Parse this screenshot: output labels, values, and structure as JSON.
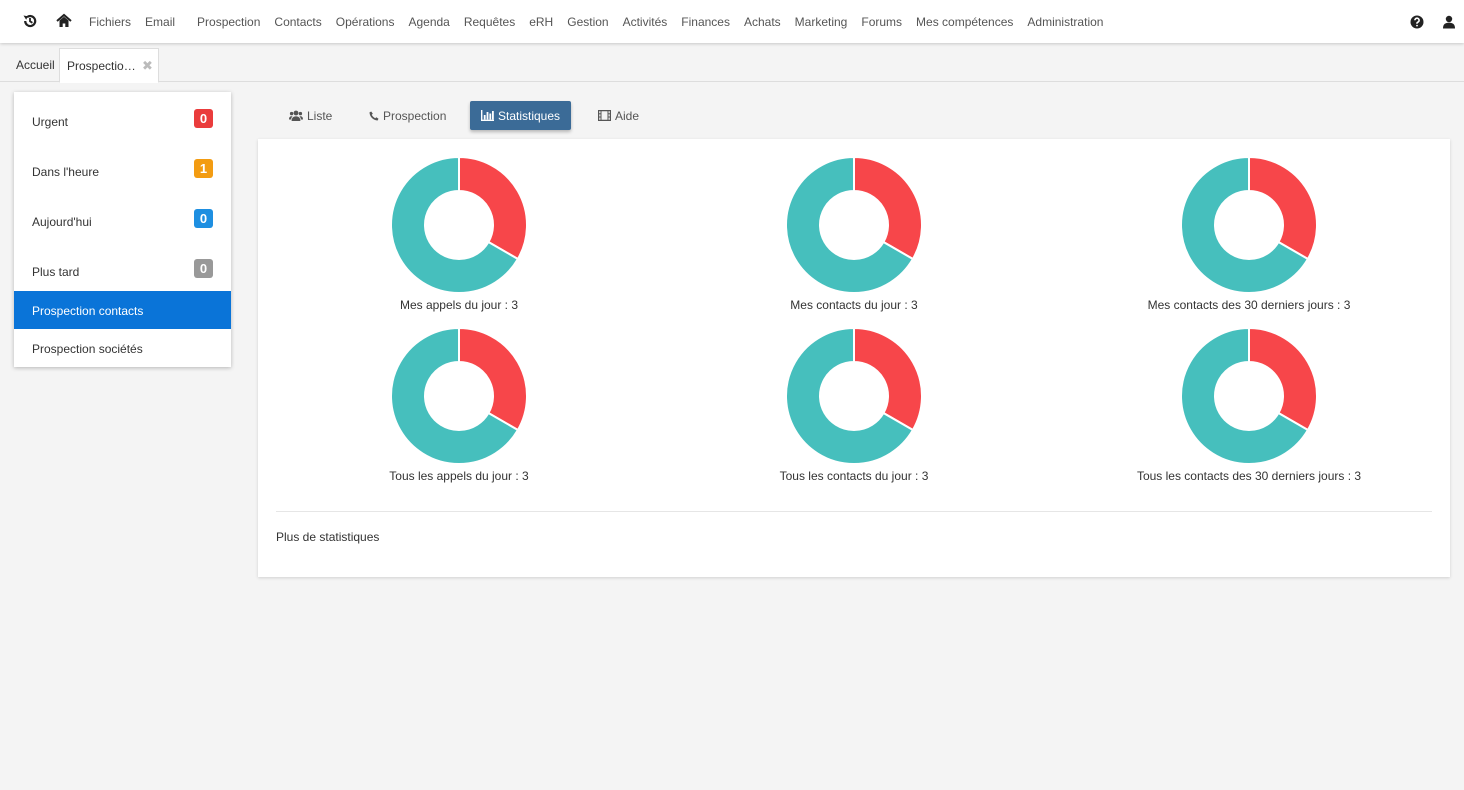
{
  "nav": {
    "items": [
      "Fichiers",
      "Email",
      "Prospection",
      "Contacts",
      "Opérations",
      "Agenda",
      "Requêtes",
      "eRH",
      "Gestion",
      "Activités",
      "Finances",
      "Achats",
      "Marketing",
      "Forums",
      "Mes compétences",
      "Administration"
    ]
  },
  "tabs": {
    "home": "Accueil",
    "active": "Prospectio…",
    "close": "✖"
  },
  "sidebar": {
    "items": [
      {
        "label": "Urgent",
        "count": "0",
        "color": "#ea3c3c"
      },
      {
        "label": "Dans l'heure",
        "count": "1",
        "color": "#f39c12"
      },
      {
        "label": "Aujourd'hui",
        "count": "0",
        "color": "#1e8fe1"
      },
      {
        "label": "Plus tard",
        "count": "0",
        "color": "#999999"
      },
      {
        "label": "Prospection contacts"
      },
      {
        "label": "Prospection sociétés"
      }
    ]
  },
  "content_tabs": [
    "Liste",
    "Prospection",
    "Statistiques",
    "Aide"
  ],
  "colors": {
    "red": "#f7464a",
    "teal": "#46bfbd",
    "accent": "#3b6b97",
    "active_blue": "#0a74d8"
  },
  "chart_data": [
    {
      "type": "pie",
      "title": "Mes appels du jour : 3",
      "values": [
        1,
        2
      ],
      "colors": [
        "#f7464a",
        "#46bfbd"
      ]
    },
    {
      "type": "pie",
      "title": "Mes contacts du jour : 3",
      "values": [
        1,
        2
      ],
      "colors": [
        "#f7464a",
        "#46bfbd"
      ]
    },
    {
      "type": "pie",
      "title": "Mes contacts des 30 derniers jours : 3",
      "values": [
        1,
        2
      ],
      "colors": [
        "#f7464a",
        "#46bfbd"
      ]
    },
    {
      "type": "pie",
      "title": "Tous les appels du jour : 3",
      "values": [
        1,
        2
      ],
      "colors": [
        "#f7464a",
        "#46bfbd"
      ]
    },
    {
      "type": "pie",
      "title": "Tous les contacts du jour : 3",
      "values": [
        1,
        2
      ],
      "colors": [
        "#f7464a",
        "#46bfbd"
      ]
    },
    {
      "type": "pie",
      "title": "Tous les contacts des 30 derniers jours : 3",
      "values": [
        1,
        2
      ],
      "colors": [
        "#f7464a",
        "#46bfbd"
      ]
    }
  ],
  "more_stats": "Plus de statistiques"
}
